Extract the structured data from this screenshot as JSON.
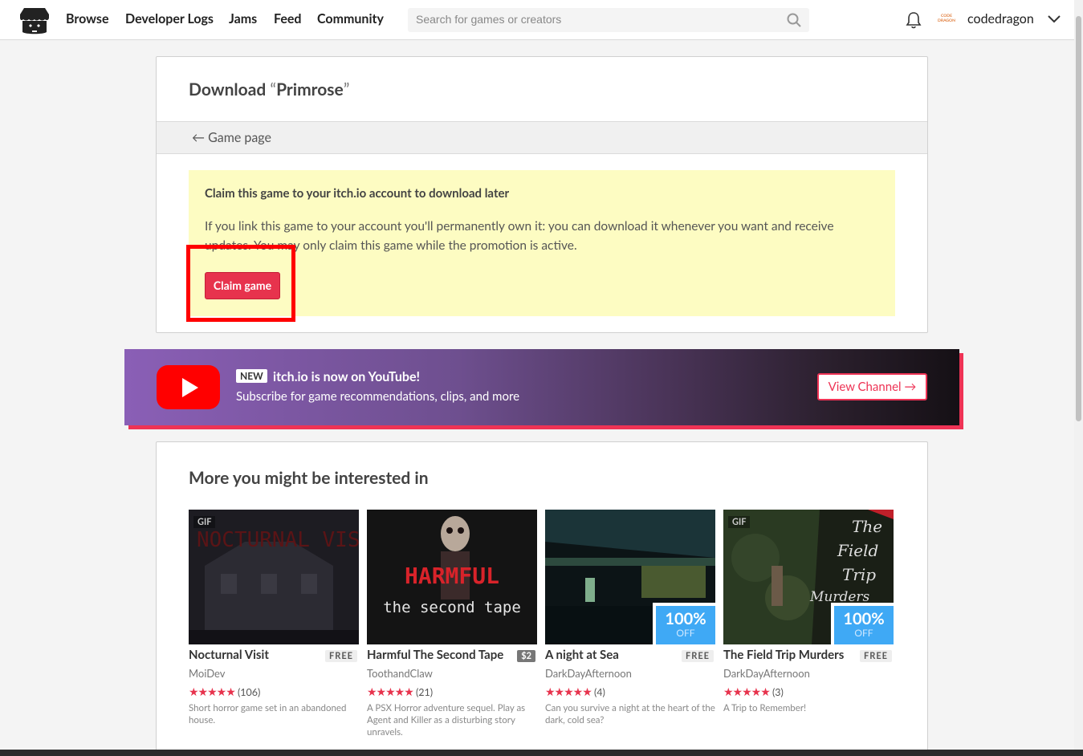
{
  "header": {
    "nav": [
      "Browse",
      "Developer Logs",
      "Jams",
      "Feed",
      "Community"
    ],
    "search_placeholder": "Search for games or creators",
    "avatar_text": "CODE DRAGON",
    "username": "codedragon"
  },
  "download": {
    "title_prefix": "Download ",
    "open_quote": "“",
    "game_name": "Primrose",
    "close_quote": "”",
    "back_label": "← Game page",
    "claim_title": "Claim this game to your itch.io account to download later",
    "claim_text": "If you link this game to your account you'll permanently own it: you can download it whenever you want and receive updates. You may only claim this game while the promotion is active.",
    "claim_button": "Claim game"
  },
  "youtube": {
    "badge": "NEW",
    "title": "itch.io is now on YouTube!",
    "subtitle": "Subscribe for game recommendations, clips, and more",
    "button": "View Channel →"
  },
  "recommendations": {
    "title": "More you might be interested in",
    "games": [
      {
        "title": "Nocturnal Visit",
        "price": "FREE",
        "author": "MoiDev",
        "rating_count": "(106)",
        "description": "Short horror game set in an abandoned house.",
        "gif": "GIF",
        "sale": null
      },
      {
        "title": "Harmful The Second Tape",
        "price": "$2",
        "author": "ToothandClaw",
        "rating_count": "(21)",
        "description": "A PSX Horror adventure sequel. Play as Agent and Killer as a disturbing story unravels.",
        "gif": null,
        "sale": null
      },
      {
        "title": "A night at Sea",
        "price": "FREE",
        "author": "DarkDayAfternoon",
        "rating_count": "(4)",
        "description": "Can you survive a night at the heart of the dark, cold sea?",
        "gif": null,
        "sale": {
          "pct": "100%",
          "off": "OFF"
        }
      },
      {
        "title": "The Field Trip Murders",
        "price": "FREE",
        "author": "DarkDayAfternoon",
        "rating_count": "(3)",
        "description": "A Trip to Remember!",
        "gif": "GIF",
        "sale": {
          "pct": "100%",
          "off": "OFF"
        }
      }
    ],
    "stars": "★★★★★",
    "thumb_text": {
      "nocturnal": "NOCTURNAL VISIT",
      "harmful_1": "HARMFUL",
      "harmful_2": "the second tape",
      "field_1": "The",
      "field_2": "Field",
      "field_3": "Trip",
      "field_4": "Murders"
    }
  },
  "colors": {
    "accent": "#e7334d",
    "youtube_red": "#ff0000",
    "sale_blue": "#3fa9f5",
    "claim_bg": "#fdfcc2"
  }
}
